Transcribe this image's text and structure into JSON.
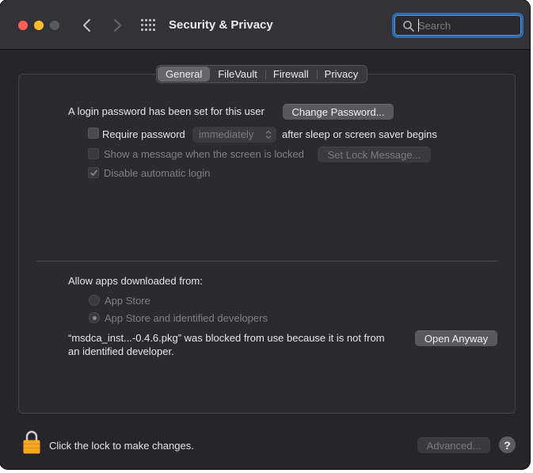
{
  "window": {
    "title": "Security & Privacy"
  },
  "search": {
    "placeholder": "Search",
    "value": ""
  },
  "tabs": [
    {
      "label": "General",
      "active": true
    },
    {
      "label": "FileVault",
      "active": false
    },
    {
      "label": "Firewall",
      "active": false
    },
    {
      "label": "Privacy",
      "active": false
    }
  ],
  "general": {
    "login_text": "A login password has been set for this user",
    "change_password_label": "Change Password...",
    "require_password_label": "Require password",
    "require_password_checked": false,
    "require_password_delay": "immediately",
    "require_password_suffix": "after sleep or screen saver begins",
    "show_message_label": "Show a message when the screen is locked",
    "show_message_checked": false,
    "set_lock_message_label": "Set Lock Message...",
    "disable_auto_login_label": "Disable automatic login",
    "disable_auto_login_checked": true
  },
  "downloads": {
    "heading": "Allow apps downloaded from:",
    "options": [
      {
        "label": "App Store",
        "selected": false
      },
      {
        "label": "App Store and identified developers",
        "selected": true
      }
    ],
    "blocked_line1": "“msdca_inst...-0.4.6.pkg” was blocked from use because it is not from",
    "blocked_line2": "an identified developer.",
    "open_anyway_label": "Open Anyway"
  },
  "footer": {
    "lock_text": "Click the lock to make changes.",
    "advanced_label": "Advanced...",
    "help_label": "?"
  },
  "colors": {
    "lock": "#f5a623",
    "focus_ring": "#2b6cb0"
  }
}
